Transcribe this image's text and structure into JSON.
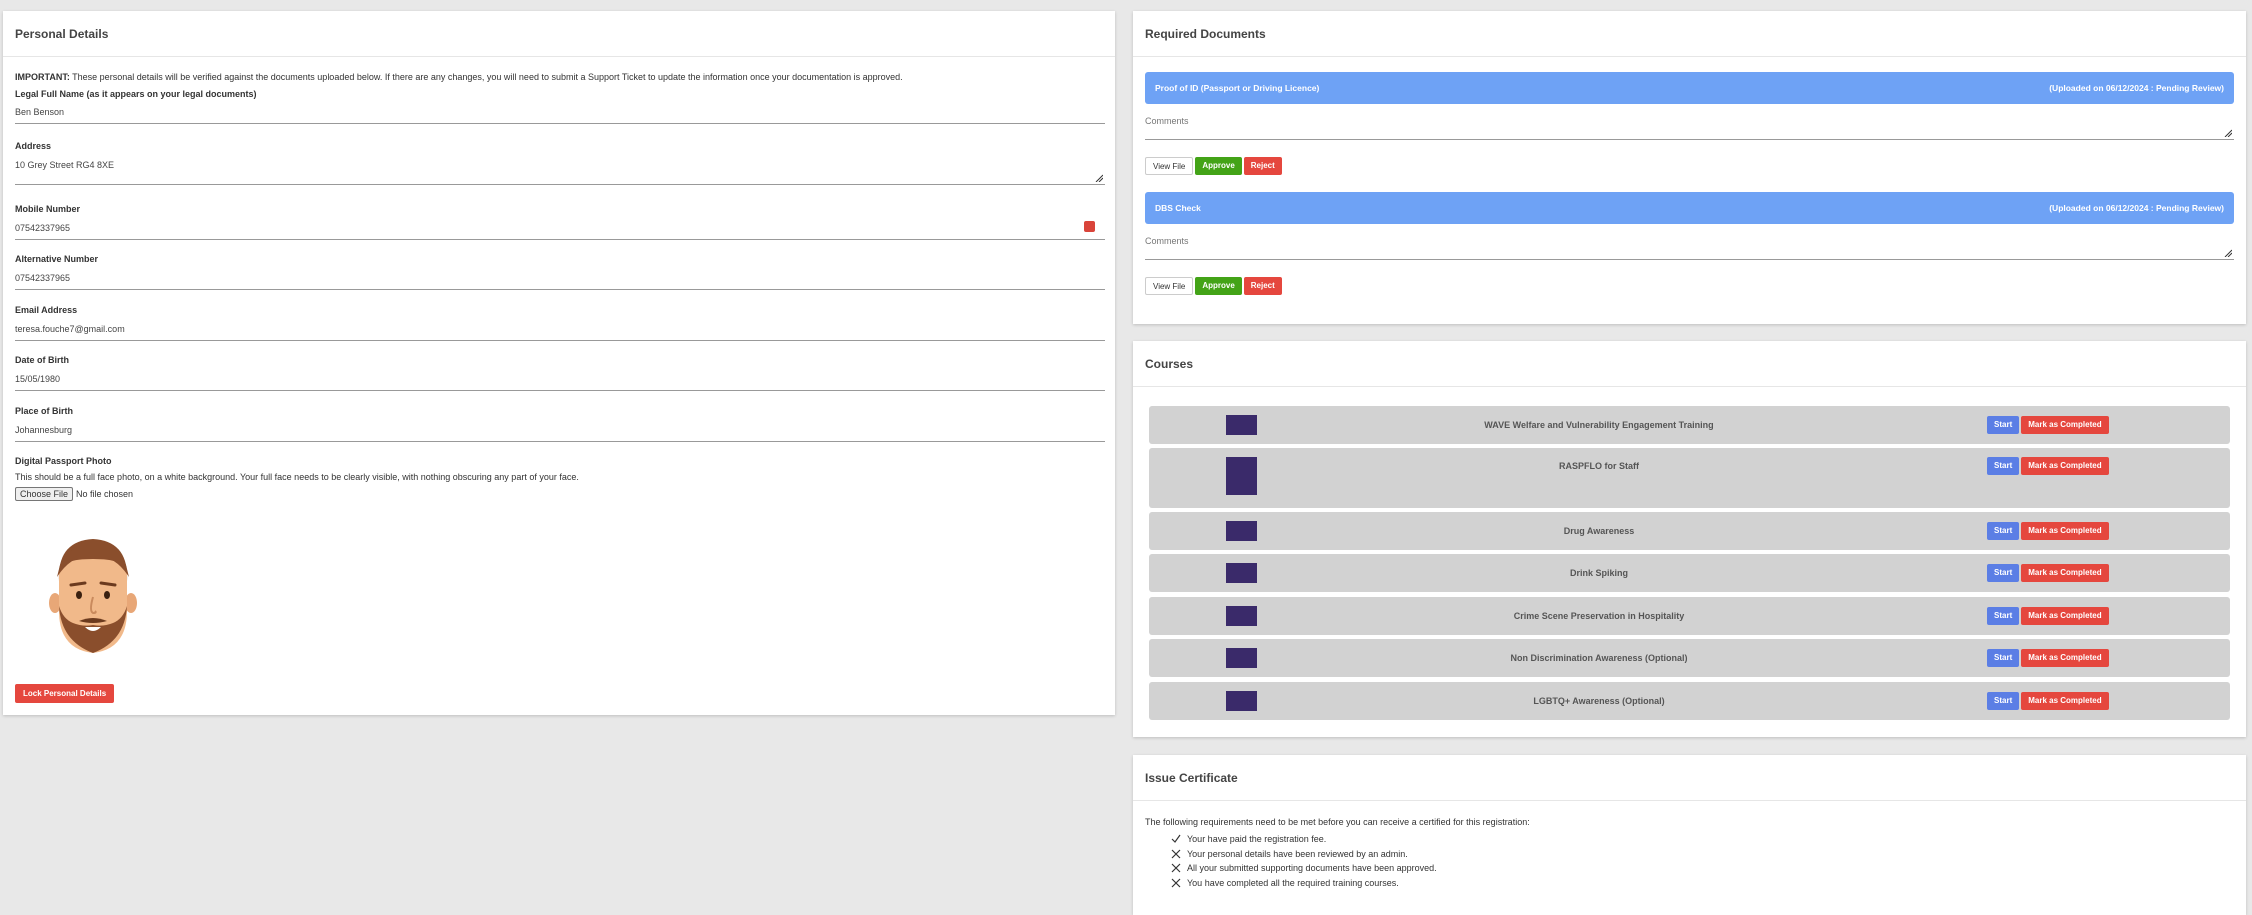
{
  "personal": {
    "title": "Personal Details",
    "notice_strong": "IMPORTANT:",
    "notice_text": " These personal details will be verified against the documents uploaded below. If there are any changes, you will need to submit a Support Ticket to update the information once your documentation is approved.",
    "fields": [
      {
        "label": "Legal Full Name (as it appears on your legal documents)",
        "value": "Ben Benson"
      },
      {
        "label": "Address",
        "value": "10 Grey Street RG4 8XE"
      },
      {
        "label": "Mobile Number",
        "value": "07542337965"
      },
      {
        "label": "Alternative Number",
        "value": "07542337965"
      },
      {
        "label": "Email Address",
        "value": "teresa.fouche7@gmail.com"
      },
      {
        "label": "Date of Birth",
        "value": "15/05/1980"
      },
      {
        "label": "Place of Birth",
        "value": "Johannesburg"
      }
    ],
    "photo_label": "Digital Passport Photo",
    "photo_help": "This should be a full face photo, on a white background. Your full face needs to be clearly visible, with nothing obscuring any part of your face.",
    "choose_file": "Choose File",
    "no_file": "No file chosen",
    "lock_button": "Lock Personal Details"
  },
  "documents": {
    "title": "Required Documents",
    "items": [
      {
        "name": "Proof of ID (Passport or Driving Licence)",
        "status": "(Uploaded on 06/12/2024 : Pending Review)",
        "comments_placeholder": "Comments"
      },
      {
        "name": "DBS Check",
        "status": "(Uploaded on 06/12/2024 : Pending Review)",
        "comments_placeholder": "Comments"
      }
    ],
    "view_label": "View File",
    "approve_label": "Approve",
    "reject_label": "Reject"
  },
  "courses": {
    "title": "Courses",
    "start_label": "Start",
    "mark_label": "Mark as Completed",
    "items": [
      {
        "title": "WAVE Welfare and Vulnerability Engagement Training"
      },
      {
        "title": "RASPFLO for Staff"
      },
      {
        "title": "Drug Awareness"
      },
      {
        "title": "Drink Spiking"
      },
      {
        "title": "Crime Scene Preservation in Hospitality"
      },
      {
        "title": "Non Discrimination Awareness (Optional)"
      },
      {
        "title": "LGBTQ+ Awareness (Optional)"
      }
    ]
  },
  "certificate": {
    "title": "Issue Certificate",
    "intro": "The following requirements need to be met before you can receive a certified for this registration:",
    "requirements": [
      {
        "text": "Your have paid the registration fee.",
        "met": true,
        "icon": "check-icon"
      },
      {
        "text": "Your personal details have been reviewed by an admin.",
        "met": false,
        "icon": "cross-icon"
      },
      {
        "text": "All your submitted supporting documents have been approved.",
        "met": false,
        "icon": "cross-icon"
      },
      {
        "text": "You have completed all the required training courses.",
        "met": false,
        "icon": "cross-icon"
      }
    ]
  },
  "colors": {
    "doc_bar": "#6ea2f5",
    "approve": "#43a317",
    "reject": "#e5473e",
    "start": "#5b7ee5",
    "course_bg": "#d2d2d2"
  }
}
